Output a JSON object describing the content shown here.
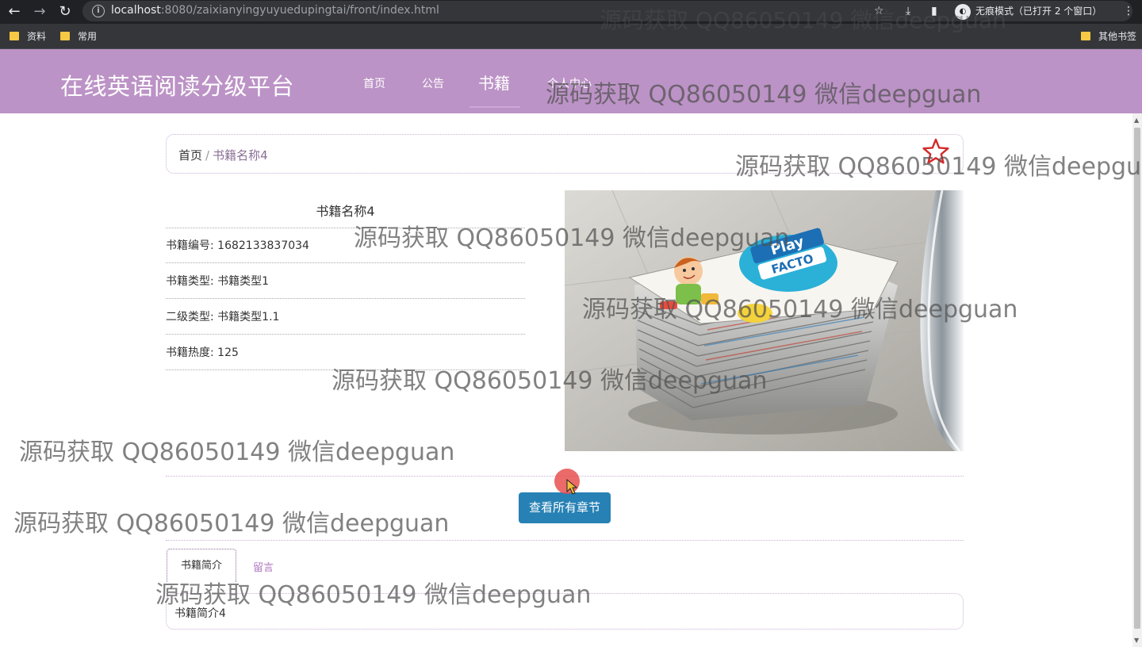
{
  "browser": {
    "url_host": "localhost",
    "url_path": ":8080/zaixianyingyuyuedupingtai/front/index.html",
    "incognito_label": "无痕模式（已打开 2 个窗口）",
    "bookmarks": [
      "资料",
      "常用"
    ],
    "other_bookmarks": "其他书签"
  },
  "site": {
    "title": "在线英语阅读分级平台",
    "nav": [
      "首页",
      "公告",
      "书籍",
      "个人中心"
    ],
    "active_nav": "书籍"
  },
  "breadcrumb": {
    "home": "首页",
    "separator": "/",
    "current": "书籍名称4"
  },
  "book": {
    "name": "书籍名称4",
    "fields": [
      {
        "label": "书籍编号",
        "value": "1682133837034"
      },
      {
        "label": "书籍类型",
        "value": "书籍类型1"
      },
      {
        "label": "二级类型",
        "value": "书籍类型1.1"
      },
      {
        "label": "书籍热度",
        "value": "125"
      }
    ],
    "rows_text": [
      "书籍编号: 1682133837034",
      "书籍类型: 书籍类型1",
      "二级类型: 书籍类型1.1",
      "书籍热度: 125"
    ],
    "image_alt": "Stack of Play Facto books"
  },
  "actions": {
    "view_chapters": "查看所有章节"
  },
  "tabs": [
    {
      "label": "书籍简介",
      "active": true
    },
    {
      "label": "留言",
      "active": false
    }
  ],
  "content": {
    "intro_text": "书籍简介4"
  },
  "watermark": "源码获取 QQ86050149 微信deepguan",
  "colors": {
    "header": "#bc93c6",
    "primary_button": "#2781b5",
    "accent": "#b07ac3"
  }
}
